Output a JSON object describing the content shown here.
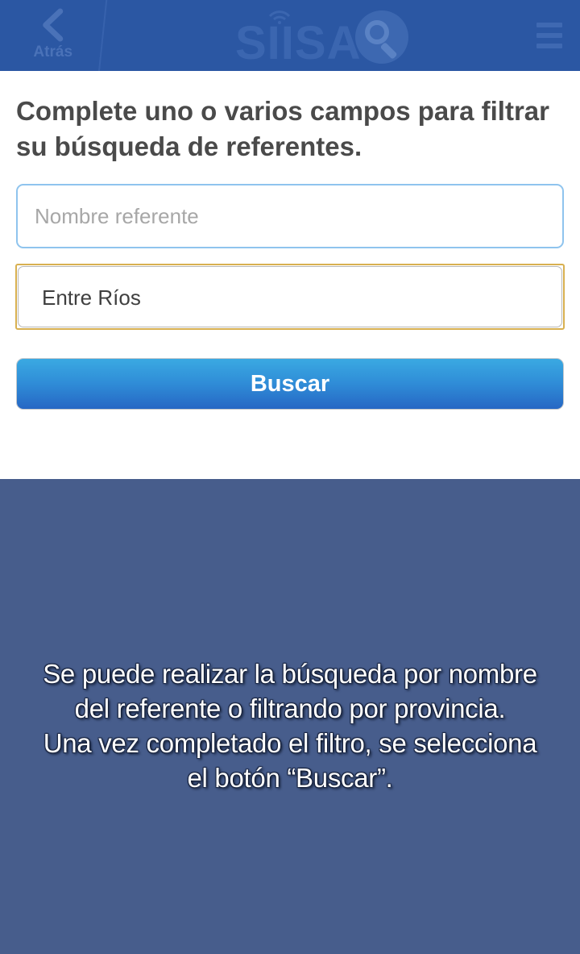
{
  "header": {
    "back_label": "Atrás",
    "logo_text": "SIISA",
    "icons": {
      "back": "chevron-left-icon",
      "menu": "hamburger-menu-icon",
      "logo": "siisa-logo"
    },
    "colors": {
      "background": "#2b57a3"
    }
  },
  "form": {
    "instructions": "Complete uno o varios campos para filtrar su búsqueda de referentes.",
    "name_field": {
      "placeholder": "Nombre referente",
      "value": ""
    },
    "province_field": {
      "value": "Entre Ríos"
    },
    "search_button_label": "Buscar"
  },
  "overlay": {
    "line1": "Se puede realizar la búsqueda por nombre",
    "line2": "del referente o filtrando por provincia.",
    "line3": "Una vez completado el filtro, se selecciona",
    "line4": "el botón “Buscar”.",
    "colors": {
      "background": "#475d8c"
    }
  }
}
